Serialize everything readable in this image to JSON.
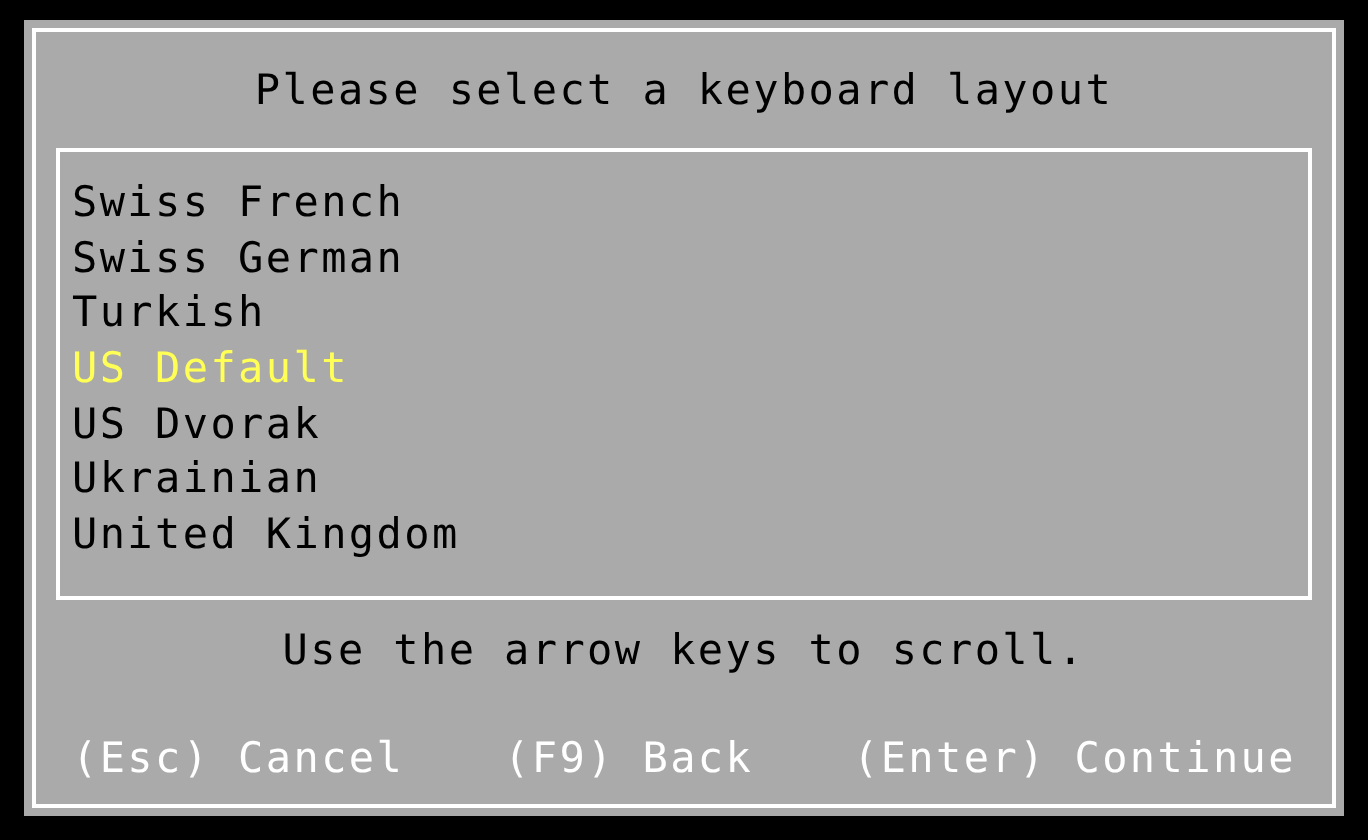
{
  "dialog": {
    "title": "Please select a keyboard layout"
  },
  "layouts": [
    {
      "label": "Swiss French",
      "selected": false
    },
    {
      "label": "Swiss German",
      "selected": false
    },
    {
      "label": "Turkish",
      "selected": false
    },
    {
      "label": "US Default",
      "selected": true
    },
    {
      "label": "US Dvorak",
      "selected": false
    },
    {
      "label": "Ukrainian",
      "selected": false
    },
    {
      "label": "United Kingdom",
      "selected": false
    }
  ],
  "hint": "Use the arrow keys to scroll.",
  "actions": [
    {
      "label": "(Esc) Cancel"
    },
    {
      "label": "(F9) Back"
    },
    {
      "label": "(Enter) Continue"
    }
  ]
}
